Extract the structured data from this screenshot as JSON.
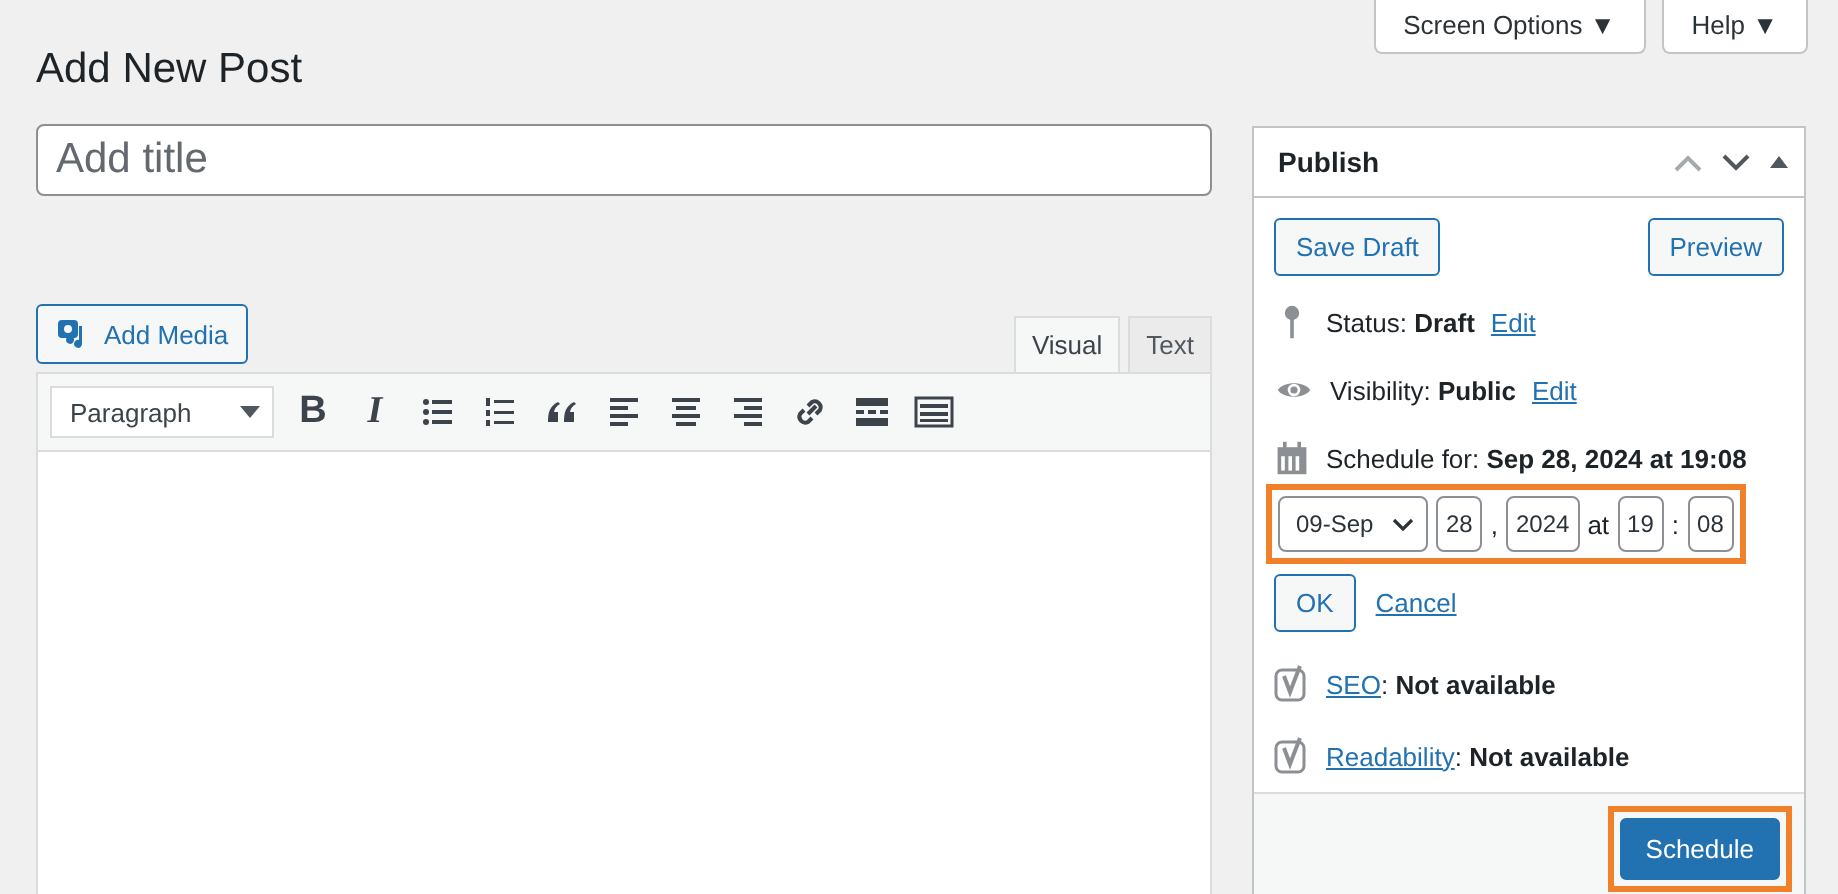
{
  "top_buttons": [
    {
      "label": "Screen Options",
      "caret": "▼"
    },
    {
      "label": "Help",
      "caret": "▼"
    }
  ],
  "page_title": "Add New Post",
  "title_field": {
    "placeholder": "Add title"
  },
  "add_media": {
    "label": "Add Media"
  },
  "editor_tabs": [
    {
      "label": "Visual",
      "selected": true
    },
    {
      "label": "Text",
      "selected": false
    }
  ],
  "format_select": {
    "value": "Paragraph"
  },
  "toolbar": [
    {
      "kind": "bold",
      "glyph": "B"
    },
    {
      "kind": "italic",
      "glyph": "I"
    },
    {
      "kind": "bullet-list"
    },
    {
      "kind": "numbered-list"
    },
    {
      "kind": "quote"
    },
    {
      "kind": "align-left"
    },
    {
      "kind": "align-center"
    },
    {
      "kind": "align-right"
    },
    {
      "kind": "link"
    },
    {
      "kind": "read-more"
    },
    {
      "kind": "toolbar-toggle"
    }
  ],
  "publish": {
    "title": "Publish",
    "buttons": [
      {
        "label": "Save Draft"
      },
      {
        "label": "Preview"
      }
    ],
    "rows": [
      {
        "kind": "status",
        "text": "Status: **Draft**",
        "link": "Edit"
      },
      {
        "kind": "visibility",
        "text": "Visibility: **Public**",
        "link": "Edit"
      },
      {
        "kind": "schedule",
        "text": "Schedule for: **Sep 28, 2024 at 19:08**"
      }
    ],
    "date_fields": {
      "highlighted": true,
      "month": "09-Sep",
      "day": "28",
      "sep1": ",",
      "year": "2024",
      "at": "at",
      "hour": "19",
      "sep2": ":",
      "minute": "08"
    },
    "ok": "OK",
    "cancel": "Cancel",
    "seo_rows": [
      {
        "link": "SEO",
        "text": ": **Not available**"
      },
      {
        "link": "Readability",
        "text": ": **Not available**"
      }
    ],
    "schedule_button": {
      "label": "Schedule",
      "highlighted": true
    }
  }
}
